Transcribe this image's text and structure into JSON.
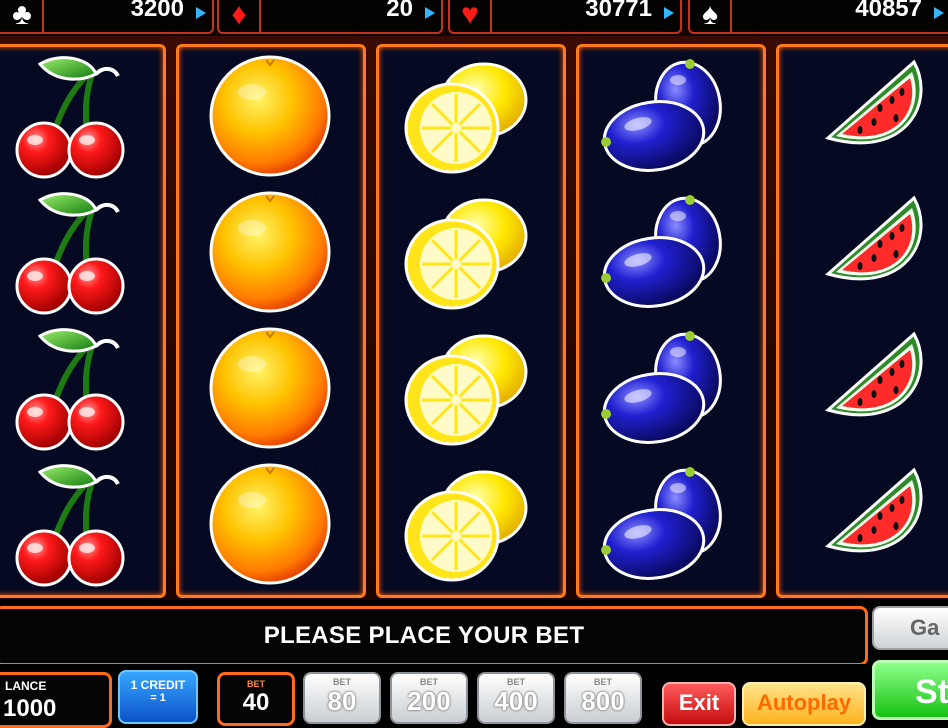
{
  "jackpots": [
    {
      "suit": "clubs-icon",
      "glyph": "♣",
      "color": "#ffffff",
      "value": "3200"
    },
    {
      "suit": "diamonds-icon",
      "glyph": "♦",
      "color": "#ff1a1a",
      "value": "20"
    },
    {
      "suit": "hearts-icon",
      "glyph": "♥",
      "color": "#ff1a1a",
      "value": "30771"
    },
    {
      "suit": "spades-icon",
      "glyph": "♠",
      "color": "#ffffff",
      "value": "40857"
    }
  ],
  "reels": [
    {
      "symbol": "cherry",
      "count": 4
    },
    {
      "symbol": "orange",
      "count": 4
    },
    {
      "symbol": "lemon",
      "count": 4
    },
    {
      "symbol": "plum",
      "count": 4
    },
    {
      "symbol": "watermelon",
      "count": 4
    }
  ],
  "message": "PLEASE PLACE YOUR BET",
  "gamble_label": "Ga",
  "balance": {
    "label": "LANCE",
    "value": "1000"
  },
  "credit": {
    "line1": "1 CREDIT",
    "line2": "= 1"
  },
  "bet": {
    "label": "BET",
    "value": "40"
  },
  "bet_options": [
    {
      "label": "BET",
      "value": "80"
    },
    {
      "label": "BET",
      "value": "200"
    },
    {
      "label": "BET",
      "value": "400"
    },
    {
      "label": "BET",
      "value": "800"
    }
  ],
  "exit_label": "Exit",
  "autoplay_label": "Autoplay",
  "start_label": "St",
  "colors": {
    "accent": "#ff6a1c",
    "reel_bg": "#050a22",
    "start": "#17c312",
    "credit": "#0b53c8"
  }
}
